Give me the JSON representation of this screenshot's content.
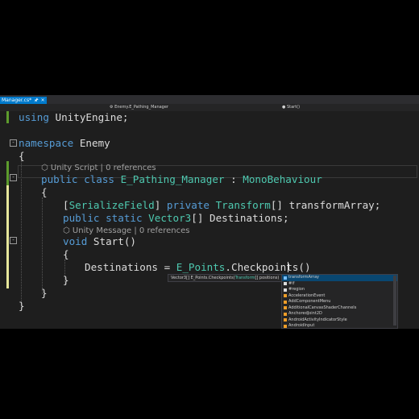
{
  "tab": {
    "title": "Manager.cs*",
    "pin_icon": "pin-icon",
    "close_icon": "close-icon"
  },
  "navbar": {
    "class_path": "Enemy.E_Pathing_Manager",
    "member": "Start()"
  },
  "code": {
    "l1_kw": "using",
    "l1_rest": " UnityEngine;",
    "l2_kw": "namespace",
    "l2_rest": " Enemy",
    "brace_open": "{",
    "brace_close": "}",
    "lens1": "Unity Script | 0 references",
    "l3_kw1": "public",
    "l3_kw2": " class",
    "l3_name": " E_Pathing_Manager",
    "l3_colon": " : ",
    "l3_base": "MonoBehaviour",
    "l4_attr_open": "[",
    "l4_attr": "SerializeField",
    "l4_attr_close": "]",
    "l4_kw": " private",
    "l4_type": " Transform",
    "l4_rest": "[] transformArray;",
    "l5_kw1": "public",
    "l5_kw2": " static",
    "l5_type": " Vector3",
    "l5_rest": "[] Destinations;",
    "lens2": "Unity Message | 0 references",
    "l6_kw": "void",
    "l6_rest": " Start()",
    "l7_lhs": "Destinations = ",
    "l7_type": "E_Points",
    "l7_rest": ".Checkpoints()"
  },
  "hint": {
    "prefix": "Vector3[] E_Points.Checkpoints(",
    "type": "Transform",
    "suffix": "[] positions)"
  },
  "autocomplete": {
    "items": [
      {
        "label": "transformArray",
        "kind": "field",
        "selected": true
      },
      {
        "label": "#if",
        "kind": "snippet"
      },
      {
        "label": "#region",
        "kind": "snippet"
      },
      {
        "label": "AccelerationEvent",
        "kind": "class"
      },
      {
        "label": "AddComponentMenu",
        "kind": "class"
      },
      {
        "label": "AdditionalCanvasShaderChannels",
        "kind": "class"
      },
      {
        "label": "AnchoredJoint2D",
        "kind": "class"
      },
      {
        "label": "AndroidActivityIndicatorStyle",
        "kind": "class"
      },
      {
        "label": "AndroidInput",
        "kind": "class"
      }
    ]
  },
  "colors": {
    "keyword": "#569cd6",
    "type": "#4ec9b0",
    "text": "#dcdcdc",
    "lens": "#a0a0a0",
    "tab": "#007acc",
    "change_bar": "#5d9c2d",
    "edit_bar": "#e6e69a"
  }
}
